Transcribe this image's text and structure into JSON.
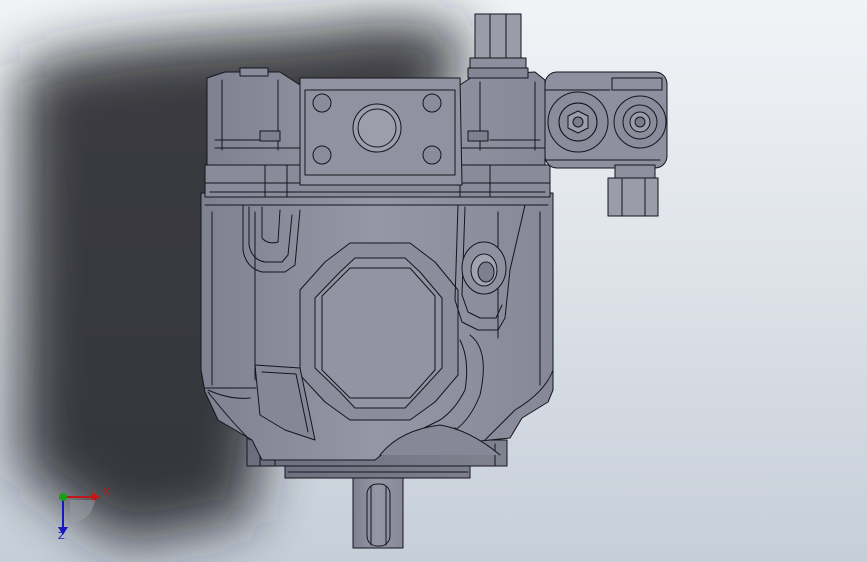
{
  "viewport": {
    "background_top": "#f1f3f6",
    "background_bottom": "#c6ced8",
    "model_fill": "#8d8f9e",
    "model_edge": "#15151c"
  },
  "triad": {
    "x_label": "X",
    "z_label": "Z",
    "x_color": "#c01818",
    "y_color": "#18a018",
    "z_color": "#1818c0"
  }
}
